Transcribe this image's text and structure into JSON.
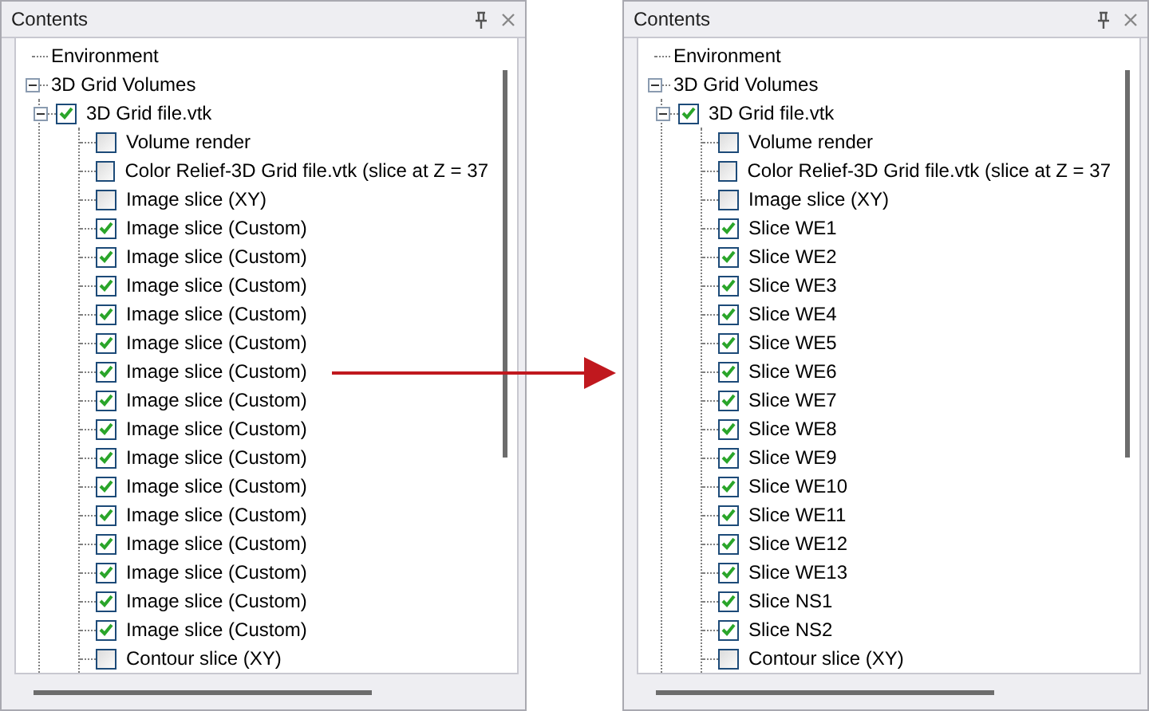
{
  "panels": [
    {
      "title": "Contents",
      "items": [
        {
          "kind": "plain",
          "label": "Environment"
        },
        {
          "kind": "plain",
          "label": "3D Grid Volumes",
          "expanded": true,
          "children": [
            {
              "kind": "check",
              "label": "3D Grid file.vtk",
              "checked": true,
              "expanded": true,
              "children": [
                {
                  "kind": "check",
                  "label": "Volume render",
                  "checked": false
                },
                {
                  "kind": "check",
                  "label": "Color Relief-3D Grid file.vtk (slice at Z = 37",
                  "checked": false
                },
                {
                  "kind": "check",
                  "label": "Image slice (XY)",
                  "checked": false
                },
                {
                  "kind": "check",
                  "label": "Image slice (Custom)",
                  "checked": true
                },
                {
                  "kind": "check",
                  "label": "Image slice (Custom)",
                  "checked": true
                },
                {
                  "kind": "check",
                  "label": "Image slice (Custom)",
                  "checked": true
                },
                {
                  "kind": "check",
                  "label": "Image slice (Custom)",
                  "checked": true
                },
                {
                  "kind": "check",
                  "label": "Image slice (Custom)",
                  "checked": true
                },
                {
                  "kind": "check",
                  "label": "Image slice (Custom)",
                  "checked": true
                },
                {
                  "kind": "check",
                  "label": "Image slice (Custom)",
                  "checked": true
                },
                {
                  "kind": "check",
                  "label": "Image slice (Custom)",
                  "checked": true
                },
                {
                  "kind": "check",
                  "label": "Image slice (Custom)",
                  "checked": true
                },
                {
                  "kind": "check",
                  "label": "Image slice (Custom)",
                  "checked": true
                },
                {
                  "kind": "check",
                  "label": "Image slice (Custom)",
                  "checked": true
                },
                {
                  "kind": "check",
                  "label": "Image slice (Custom)",
                  "checked": true
                },
                {
                  "kind": "check",
                  "label": "Image slice (Custom)",
                  "checked": true
                },
                {
                  "kind": "check",
                  "label": "Image slice (Custom)",
                  "checked": true
                },
                {
                  "kind": "check",
                  "label": "Image slice (Custom)",
                  "checked": true
                },
                {
                  "kind": "check",
                  "label": "Contour slice (XY)",
                  "checked": false
                }
              ]
            }
          ]
        }
      ]
    },
    {
      "title": "Contents",
      "items": [
        {
          "kind": "plain",
          "label": "Environment"
        },
        {
          "kind": "plain",
          "label": "3D Grid Volumes",
          "expanded": true,
          "children": [
            {
              "kind": "check",
              "label": "3D Grid file.vtk",
              "checked": true,
              "expanded": true,
              "children": [
                {
                  "kind": "check",
                  "label": "Volume render",
                  "checked": false
                },
                {
                  "kind": "check",
                  "label": "Color Relief-3D Grid file.vtk (slice at Z = 37",
                  "checked": false
                },
                {
                  "kind": "check",
                  "label": "Image slice (XY)",
                  "checked": false
                },
                {
                  "kind": "check",
                  "label": "Slice WE1",
                  "checked": true
                },
                {
                  "kind": "check",
                  "label": "Slice WE2",
                  "checked": true
                },
                {
                  "kind": "check",
                  "label": "Slice WE3",
                  "checked": true
                },
                {
                  "kind": "check",
                  "label": "Slice WE4",
                  "checked": true
                },
                {
                  "kind": "check",
                  "label": "Slice WE5",
                  "checked": true
                },
                {
                  "kind": "check",
                  "label": "Slice WE6",
                  "checked": true
                },
                {
                  "kind": "check",
                  "label": "Slice WE7",
                  "checked": true
                },
                {
                  "kind": "check",
                  "label": "Slice WE8",
                  "checked": true
                },
                {
                  "kind": "check",
                  "label": "Slice WE9",
                  "checked": true
                },
                {
                  "kind": "check",
                  "label": "Slice WE10",
                  "checked": true
                },
                {
                  "kind": "check",
                  "label": "Slice WE11",
                  "checked": true
                },
                {
                  "kind": "check",
                  "label": "Slice WE12",
                  "checked": true
                },
                {
                  "kind": "check",
                  "label": "Slice WE13",
                  "checked": true
                },
                {
                  "kind": "check",
                  "label": "Slice NS1",
                  "checked": true
                },
                {
                  "kind": "check",
                  "label": "Slice NS2",
                  "checked": true
                },
                {
                  "kind": "check",
                  "label": "Contour slice (XY)",
                  "checked": false
                }
              ]
            }
          ]
        }
      ]
    }
  ]
}
